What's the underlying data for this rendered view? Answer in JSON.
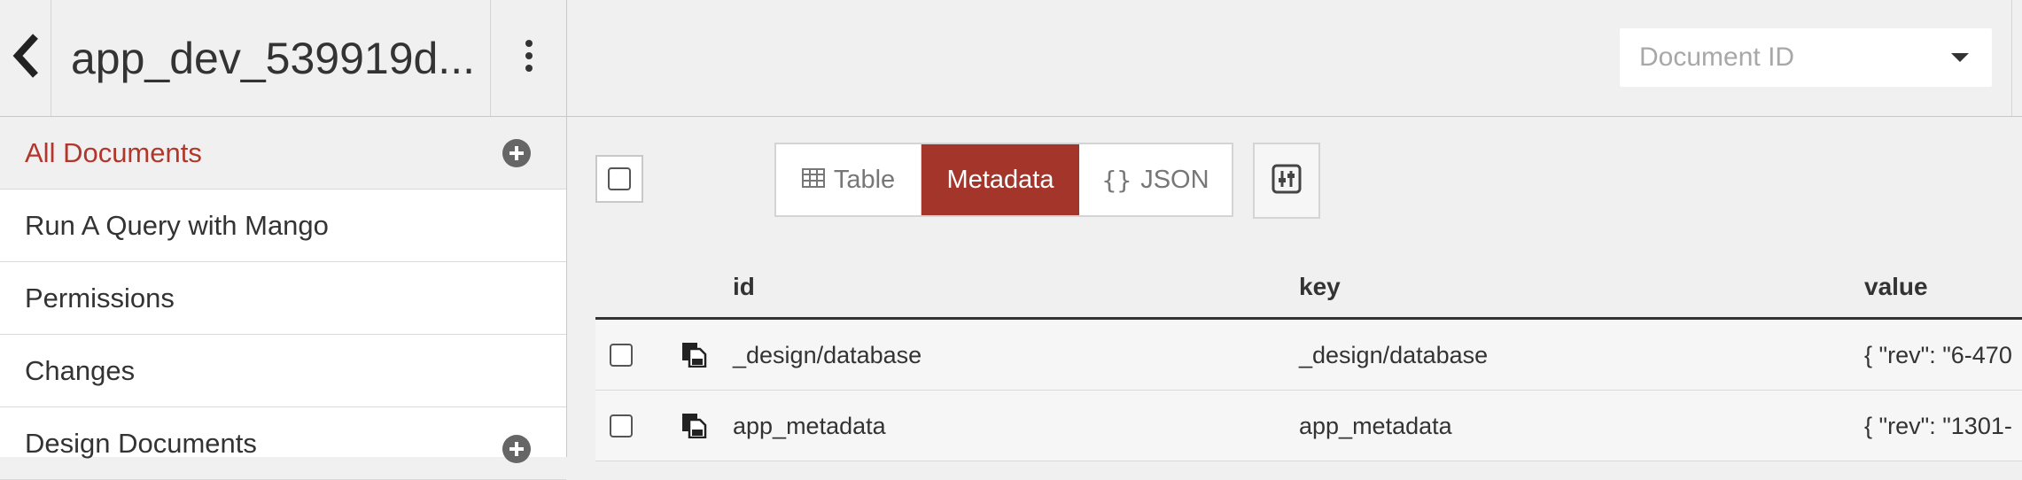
{
  "header": {
    "db_name": "app_dev_539919d...",
    "doc_id_placeholder": "Document ID"
  },
  "sidebar": {
    "items": [
      {
        "label": "All Documents",
        "active": true,
        "has_add": true
      },
      {
        "label": "Run A Query with Mango",
        "active": false,
        "has_add": false
      },
      {
        "label": "Permissions",
        "active": false,
        "has_add": false
      },
      {
        "label": "Changes",
        "active": false,
        "has_add": false
      },
      {
        "label": "Design Documents",
        "active": false,
        "has_add": true
      }
    ]
  },
  "toolbar": {
    "table_label": "Table",
    "metadata_label": "Metadata",
    "json_label": "JSON",
    "active_view": "Metadata",
    "accent_color": "#a4352b"
  },
  "table": {
    "columns": [
      "id",
      "key",
      "value"
    ],
    "rows": [
      {
        "id": "_design/database",
        "key": "_design/database",
        "value": "{ \"rev\": \"6-470"
      },
      {
        "id": "app_metadata",
        "key": "app_metadata",
        "value": "{ \"rev\": \"1301-"
      }
    ]
  },
  "icons": {
    "back": "chevron-left-icon",
    "menu": "kebab-menu-icon",
    "dropdown": "caret-down-icon",
    "add": "plus-circle-icon",
    "table": "table-grid-icon",
    "json": "curly-braces-icon",
    "settings": "sliders-icon",
    "doc": "copy-document-icon"
  },
  "colors": {
    "accent": "#a4352b",
    "active_sidebar_text": "#b1372c"
  }
}
